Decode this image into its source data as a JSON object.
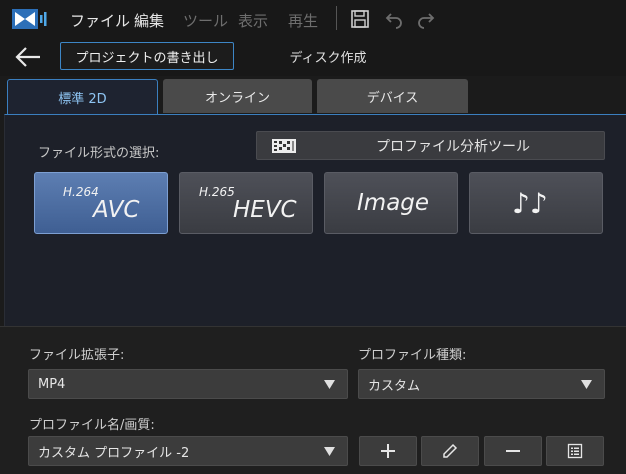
{
  "menu": {
    "items": [
      {
        "label": "ファイル",
        "enabled": true
      },
      {
        "label": "編集",
        "enabled": true
      },
      {
        "label": "ツール",
        "enabled": false
      },
      {
        "label": "表示",
        "enabled": false
      },
      {
        "label": "再生",
        "enabled": false
      }
    ]
  },
  "toolbar": {
    "save_icon": "save-icon",
    "undo_icon": "undo-icon",
    "redo_icon": "redo-icon"
  },
  "mode_tabs": {
    "active_label": "プロジェクトの書き出し",
    "disc_label": "ディスク作成"
  },
  "tabs": [
    {
      "label": "標準 2D",
      "active": true
    },
    {
      "label": "オンライン",
      "active": false
    },
    {
      "label": "デバイス",
      "active": false
    }
  ],
  "format_section": {
    "label": "ファイル形式の選択:",
    "profile_tool_label": "プロファイル分析ツール",
    "buttons": [
      {
        "sup": "H.264",
        "main": "AVC",
        "selected": true
      },
      {
        "sup": "H.265",
        "main": "HEVC",
        "selected": false
      },
      {
        "sup": "",
        "main": "Image",
        "selected": false
      },
      {
        "sup": "",
        "main": "♪♪",
        "selected": false
      }
    ]
  },
  "fields": {
    "extension_label": "ファイル拡張子:",
    "extension_value": "MP4",
    "profile_type_label": "プロファイル種類:",
    "profile_type_value": "カスタム",
    "profile_name_label": "プロファイル名/画質:",
    "profile_name_value": "カスタム プロファイル -2"
  },
  "colors": {
    "accent": "#3b7fbf",
    "selected_format": "#4f6fa3"
  }
}
